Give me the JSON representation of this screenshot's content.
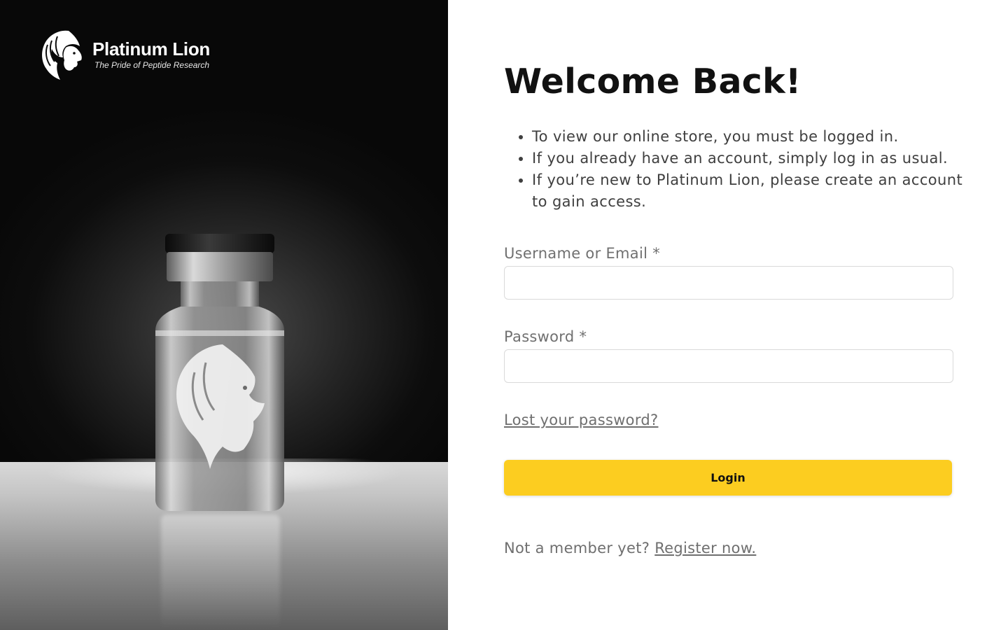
{
  "brand": {
    "name": "Platinum Lion",
    "tagline": "The Pride of Peptide Research",
    "logo_icon": "lion-head-icon"
  },
  "hero": {
    "image": "peptide-vial-with-lion-emblem"
  },
  "login": {
    "title": "Welcome Back!",
    "info_items": [
      "To view our online store, you must be logged in.",
      "If you already have an account, simply log in as usual.",
      "If you’re new to Platinum Lion, please create an account to gain access."
    ],
    "username_label": "Username or Email *",
    "username_value": "",
    "password_label": "Password *",
    "password_value": "",
    "lost_password": "Lost your password?",
    "login_button": "Login",
    "register_prompt": "Not a member yet?",
    "register_link": "Register now."
  },
  "colors": {
    "accent": "#fccd20",
    "heading": "#111111",
    "body_text": "#3f3f3f",
    "muted_text": "#707070"
  }
}
